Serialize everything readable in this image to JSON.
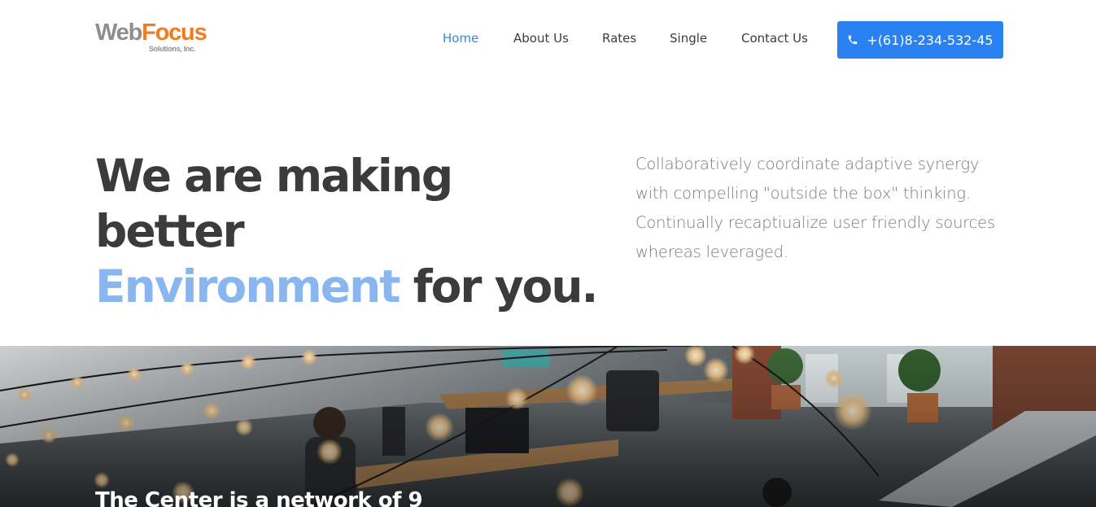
{
  "brand": {
    "name_part1": "Web",
    "name_part2": "Focus",
    "tagline": "Solutions, Inc."
  },
  "nav": {
    "items": [
      {
        "label": "Home",
        "active": true
      },
      {
        "label": "About Us",
        "active": false
      },
      {
        "label": "Rates",
        "active": false
      },
      {
        "label": "Single",
        "active": false
      },
      {
        "label": "Contact Us",
        "active": false
      }
    ],
    "phone": "+(61)8-234-532-45"
  },
  "hero": {
    "title_line1": "We are making better",
    "title_accent": "Environment",
    "title_rest": "for you.",
    "description": "Collaboratively coordinate adaptive synergy with compelling \"outside the box\" thinking. Continually recaptiualize user friendly sources whereas leveraged."
  },
  "banner": {
    "caption": "The Center is a network of 9"
  },
  "colors": {
    "accent": "#2a82f2",
    "nav_active": "#3c87d6",
    "hero_accent": "#8ab6ef",
    "logo_orange": "#ef7d1f",
    "logo_gray": "#8e8e8e"
  },
  "icons": {
    "phone_button": "phone-icon"
  }
}
